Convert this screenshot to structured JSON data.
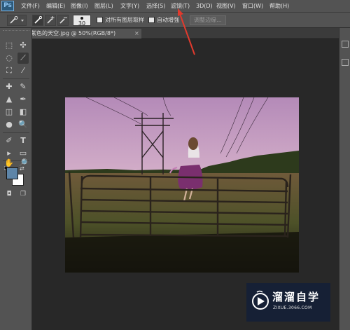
{
  "app": {
    "logo": "Ps"
  },
  "menu": [
    {
      "label": "文件(F)"
    },
    {
      "label": "编辑(E)"
    },
    {
      "label": "图像(I)"
    },
    {
      "label": "图层(L)"
    },
    {
      "label": "文字(Y)"
    },
    {
      "label": "选择(S)"
    },
    {
      "label": "滤镜(T)"
    },
    {
      "label": "3D(D)"
    },
    {
      "label": "视图(V)"
    },
    {
      "label": "窗口(W)"
    },
    {
      "label": "帮助(H)"
    }
  ],
  "options_bar": {
    "brush_size": "30",
    "sample_all_layers_label": "对所有图层取样",
    "auto_enhance_label": "自动增强",
    "refine_edge_label": "调整边缘..."
  },
  "document": {
    "tab_title": "紫色的天空.jpg @ 50%(RGB/8*)",
    "tab_close": "×"
  },
  "toolbox": {
    "tool_glyphs": [
      "⬚",
      "✣",
      "◌",
      "⟋",
      "⛶",
      "⁄",
      "✚",
      "✎",
      "▲",
      "✒",
      "◫",
      "◧",
      "●",
      "🔍",
      "✐",
      "T",
      "▸",
      "▭",
      "✋",
      "🔎"
    ]
  },
  "colors": {
    "foreground": "#5e85a8",
    "background": "#ffffff",
    "accent": "#e23a2d"
  },
  "watermark": {
    "title": "溜溜自学",
    "url": "ZIXUE.3066.COM"
  }
}
